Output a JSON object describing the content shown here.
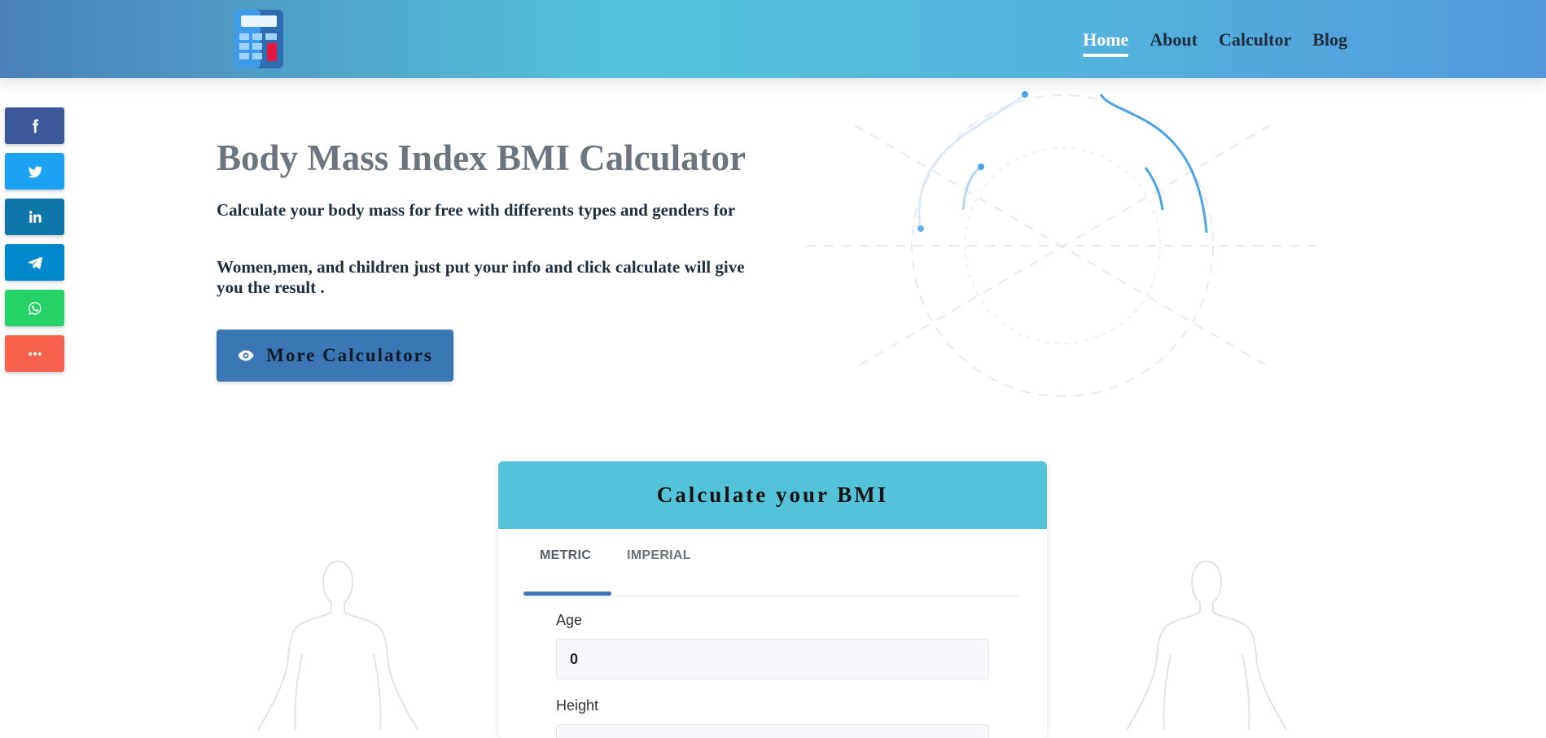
{
  "header": {
    "logo_icon": "calculator-icon",
    "nav": [
      {
        "label": "Home",
        "active": true
      },
      {
        "label": "About",
        "active": false
      },
      {
        "label": "Calcultor",
        "active": false
      },
      {
        "label": "Blog",
        "active": false
      }
    ]
  },
  "social": [
    {
      "name": "facebook-icon",
      "color": "#3b5998"
    },
    {
      "name": "twitter-icon",
      "color": "#1da1f2"
    },
    {
      "name": "linkedin-icon",
      "color": "#0e76a8"
    },
    {
      "name": "telegram-icon",
      "color": "#0088cc"
    },
    {
      "name": "whatsapp-icon",
      "color": "#25d366"
    },
    {
      "name": "more-icon",
      "color": "#f7604b"
    }
  ],
  "hero": {
    "title": "Body Mass Index BMI Calculator",
    "paragraph1": "Calculate your body mass for free with differents types and genders for",
    "paragraph2": "Women,men, and children just put your info and click calculate will give you the result .",
    "button_label": "More Calculators",
    "button_icon": "eye-icon"
  },
  "card": {
    "title": "Calculate your BMI",
    "tabs": [
      {
        "label": "METRIC",
        "active": true
      },
      {
        "label": "IMPERIAL",
        "active": false
      }
    ],
    "fields": {
      "age": {
        "label": "Age",
        "value": "0"
      },
      "height": {
        "label": "Height",
        "value": ""
      }
    }
  },
  "colors": {
    "accent": "#3b76b5",
    "card_header": "#54c3d9"
  }
}
